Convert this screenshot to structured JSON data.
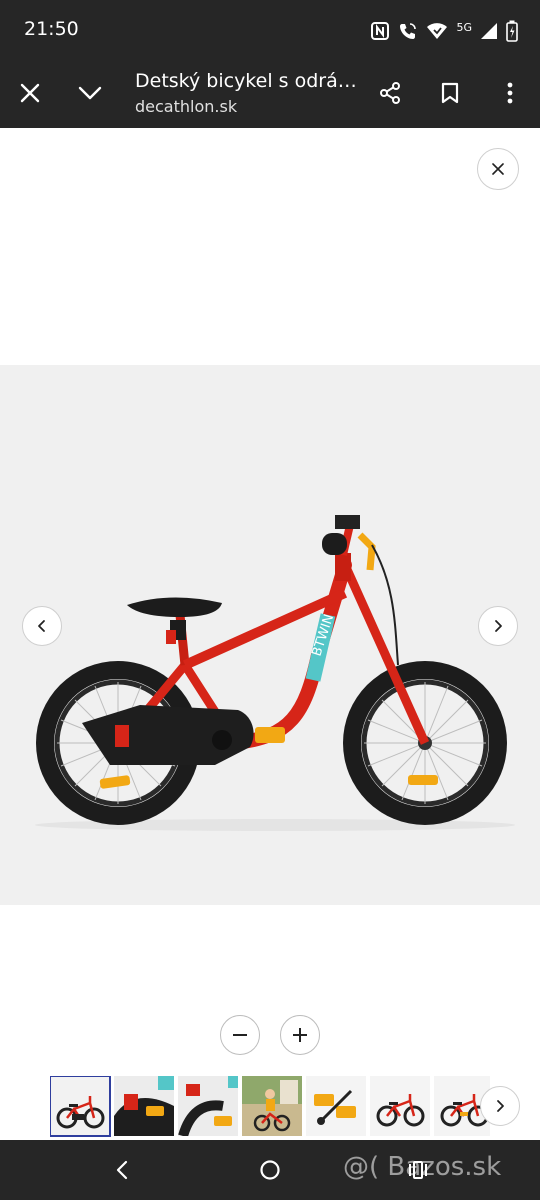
{
  "status_bar": {
    "time": "21:50",
    "network": "5G",
    "icons": [
      "nfc-icon",
      "wifi-calling-icon",
      "wifi-icon",
      "signal-icon",
      "battery-icon"
    ]
  },
  "toolbar": {
    "title": "Detský bicykel s odrá…",
    "url": "decathlon.sk",
    "icons": [
      "close-icon",
      "chevron-down-icon",
      "share-icon",
      "bookmark-icon",
      "more-vert-icon"
    ]
  },
  "gallery": {
    "brand_text": "BTWIN",
    "thumbnail_count": 7,
    "selected_index": 0
  },
  "watermark": "@( Bazos.sk",
  "colors": {
    "chrome": "#262626",
    "bike_red": "#d62518",
    "accent_yellow": "#f2a814",
    "teal_band": "#54c6c8",
    "selected_outline": "#2f3e9e",
    "photo_bg": "#f0f0f0"
  }
}
